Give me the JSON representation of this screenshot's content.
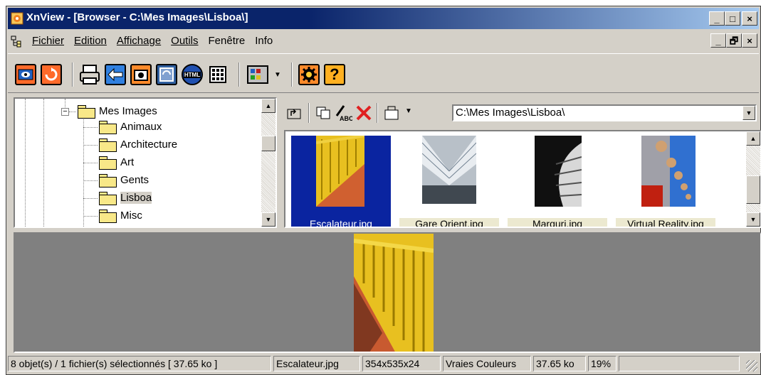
{
  "window": {
    "title": "XnView - [Browser - C:\\Mes Images\\Lisboa\\]",
    "caption_buttons": [
      "_",
      "□",
      "×"
    ],
    "mdi_buttons": [
      "_",
      "🗗",
      "×"
    ]
  },
  "menu": {
    "items": [
      {
        "label": "Fichier"
      },
      {
        "label": "Edition"
      },
      {
        "label": "Affichage"
      },
      {
        "label": "Outils"
      },
      {
        "label": "Fenêtre"
      },
      {
        "label": "Info"
      }
    ]
  },
  "toolbar": {
    "buttons": [
      "fullscreen-icon",
      "refresh-icon",
      "print-icon",
      "convert-icon",
      "capture-icon",
      "slideshow-icon",
      "html-icon",
      "contact-sheet-icon",
      "view-mode-icon",
      "settings-icon",
      "help-icon"
    ],
    "html_label": "HTML"
  },
  "tree": {
    "root": "Mes Images",
    "children": [
      "Animaux",
      "Architecture",
      "Art",
      "Gents",
      "Lisboa",
      "Misc"
    ],
    "selected": "Lisboa"
  },
  "browser": {
    "path": "C:\\Mes Images\\Lisboa\\",
    "thumbnails": [
      {
        "label": "Escalateur.jpg",
        "selected": true
      },
      {
        "label": "Gare Orient.jpg",
        "selected": false
      },
      {
        "label": "Marquri.jpg",
        "selected": false
      },
      {
        "label": "Virtual Reality.jpg",
        "selected": false
      }
    ]
  },
  "status": {
    "summary": "8 objet(s) / 1 fichier(s) sélectionnés  [ 37.65 ko ]",
    "filename": "Escalateur.jpg",
    "dimensions": "354x535x24",
    "color_mode": "Vraies Couleurs",
    "size": "37.65 ko",
    "zoom": "19%",
    "extra": ""
  },
  "colors": {
    "titlebar": "#0a246a",
    "face": "#d4d0c8",
    "selection": "#0a24a0",
    "preview_bg": "#808080"
  }
}
